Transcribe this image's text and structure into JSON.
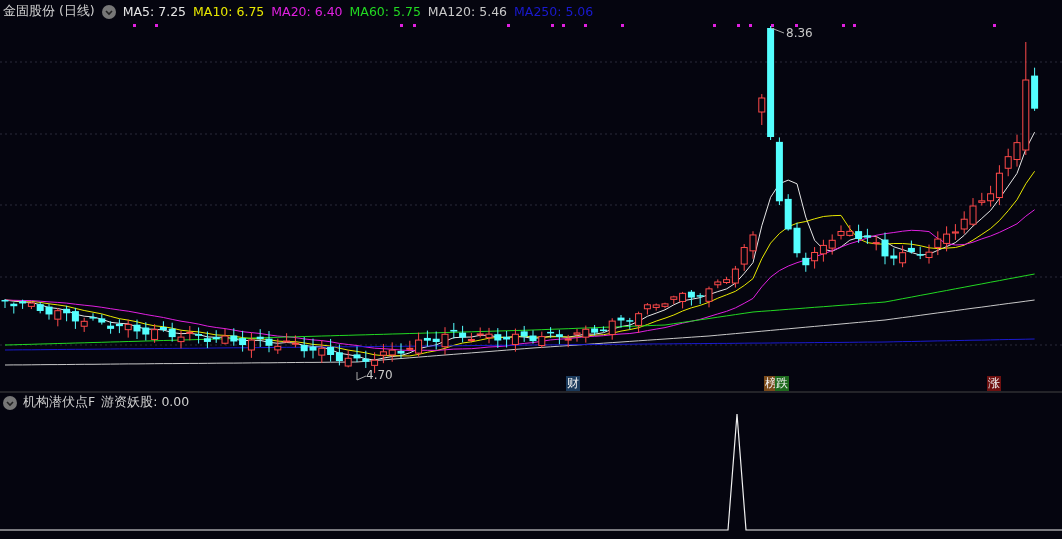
{
  "header": {
    "title": "金固股份 (日线)",
    "ma_legend": [
      {
        "label": "MA5: 7.25",
        "color": "#e6e6e6"
      },
      {
        "label": "MA10: 6.75",
        "color": "#e8e800"
      },
      {
        "label": "MA20: 6.40",
        "color": "#e020e0"
      },
      {
        "label": "MA60: 5.75",
        "color": "#22d822"
      },
      {
        "label": "MA120: 5.46",
        "color": "#c8c8c8"
      },
      {
        "label": "MA250: 5.06",
        "color": "#1a1ad0"
      }
    ]
  },
  "price_labels": {
    "high": "8.36",
    "low": "4.70"
  },
  "event_tags": [
    {
      "text": "财",
      "color": "#1b3a5c"
    },
    {
      "text": "榜",
      "color": "#7a4a1a"
    },
    {
      "text": "跌",
      "color": "#1d6a1d"
    },
    {
      "text": "涨",
      "color": "#6e1010"
    }
  ],
  "indicator": {
    "title": "机构潜伏点F",
    "reading": "游资妖股: 0.00"
  }
}
